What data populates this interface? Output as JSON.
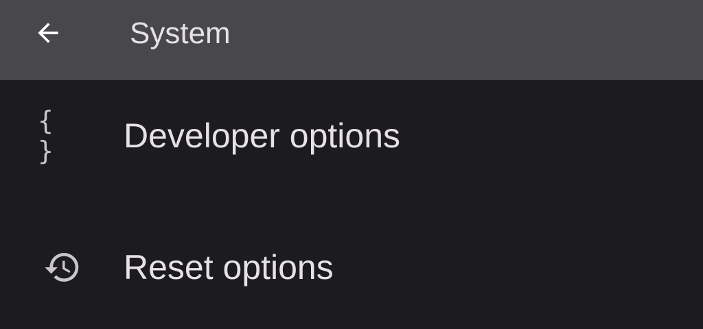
{
  "app_bar": {
    "back_icon": "arrow-back-icon",
    "title": "System"
  },
  "items": [
    {
      "icon": "code-braces-icon",
      "icon_glyph": "{ }",
      "label": "Developer options"
    },
    {
      "icon": "history-icon",
      "label": "Reset options"
    }
  ],
  "colors": {
    "app_bar_bg": "#48474b",
    "page_bg": "#1c1b1f",
    "text": "#e6e1e5",
    "icon": "#c9c5ca"
  }
}
